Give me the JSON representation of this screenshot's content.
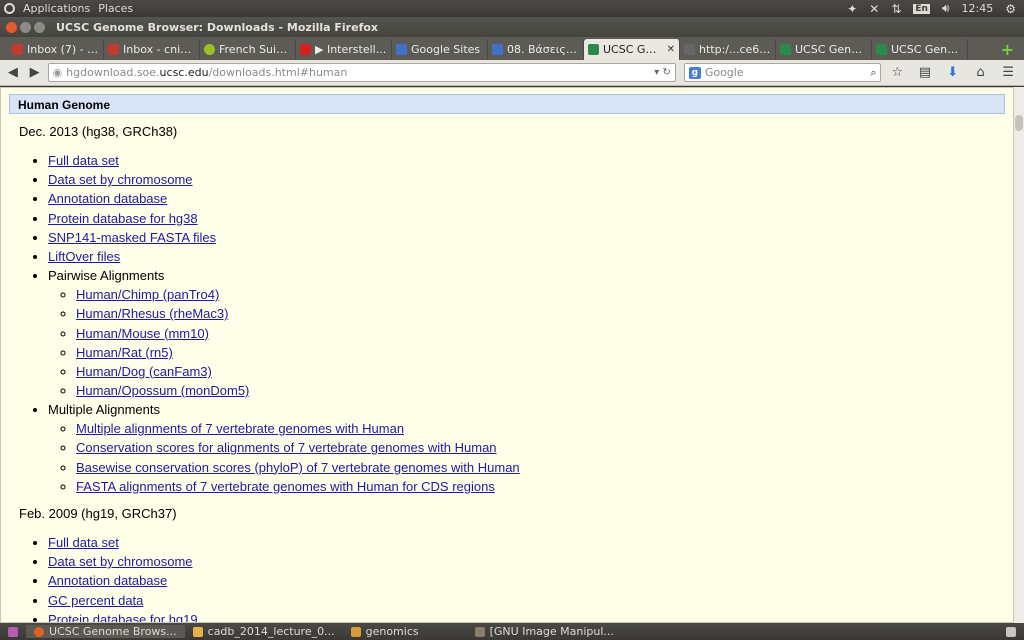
{
  "top_panel": {
    "menus": [
      "Applications",
      "Places"
    ],
    "lang": "En",
    "clock": "12:45"
  },
  "window": {
    "title": "UCSC Genome Browser: Downloads - Mozilla Firefox"
  },
  "tabs": [
    {
      "label": "Inbox (7) - c...",
      "icon_color": "#c23b2e"
    },
    {
      "label": "Inbox - cnik...",
      "icon_color": "#c23b2e"
    },
    {
      "label": "French Suite...",
      "icon_color": "#9bbf2c"
    },
    {
      "label": "▶ Interstell...",
      "icon_color": "#d62020"
    },
    {
      "label": "Google Sites",
      "icon_color": "#3f72c9"
    },
    {
      "label": "08. Βάσεις Δ...",
      "icon_color": "#3f72c9"
    },
    {
      "label": "UCSC Ge...",
      "icon_color": "#2b8a4a",
      "active": true
    },
    {
      "label": "http:/...ce66a",
      "icon_color": "#666666"
    },
    {
      "label": "UCSC Geno...",
      "icon_color": "#2b8a4a"
    },
    {
      "label": "UCSC Geno...",
      "icon_color": "#2b8a4a"
    }
  ],
  "navbar": {
    "url_prefix": "hgdownload.soe.",
    "url_domain": "ucsc.edu",
    "url_suffix": "/downloads.html#human",
    "search_placeholder": "Google"
  },
  "content": {
    "section_title": "Human Genome",
    "releases": [
      {
        "title": "Dec. 2013 (hg38, GRCh38)",
        "links": [
          "Full data set",
          "Data set by chromosome",
          "Annotation database",
          "Protein database for hg38",
          "SNP141-masked FASTA files",
          "LiftOver files"
        ],
        "pairwise_label": "Pairwise Alignments",
        "pairwise": [
          "Human/Chimp (panTro4)",
          "Human/Rhesus (rheMac3)",
          "Human/Mouse (mm10)",
          "Human/Rat (rn5)",
          "Human/Dog (canFam3)",
          "Human/Opossum (monDom5)"
        ],
        "multiple_label": "Multiple Alignments",
        "multiple": [
          "Multiple alignments of 7 vertebrate genomes with Human",
          "Conservation scores for alignments of 7 vertebrate genomes with Human",
          "Basewise conservation scores (phyloP) of 7 vertebrate genomes with Human",
          "FASTA alignments of 7 vertebrate genomes with Human for CDS regions"
        ]
      },
      {
        "title": "Feb. 2009 (hg19, GRCh37)",
        "links": [
          "Full data set",
          "Data set by chromosome",
          "Annotation database",
          "GC percent data",
          "Protein database for hg19"
        ]
      }
    ]
  },
  "taskbar": [
    {
      "label": "UCSC Genome Brows...",
      "icon_color": "#e0621c",
      "active": true
    },
    {
      "label": "cadb_2014_lecture_0...",
      "icon_color": "#e8b04a"
    },
    {
      "label": "genomics",
      "icon_color": "#d99a3a"
    },
    {
      "label": "[GNU Image Manipul...",
      "icon_color": "#8b7d6b"
    }
  ]
}
